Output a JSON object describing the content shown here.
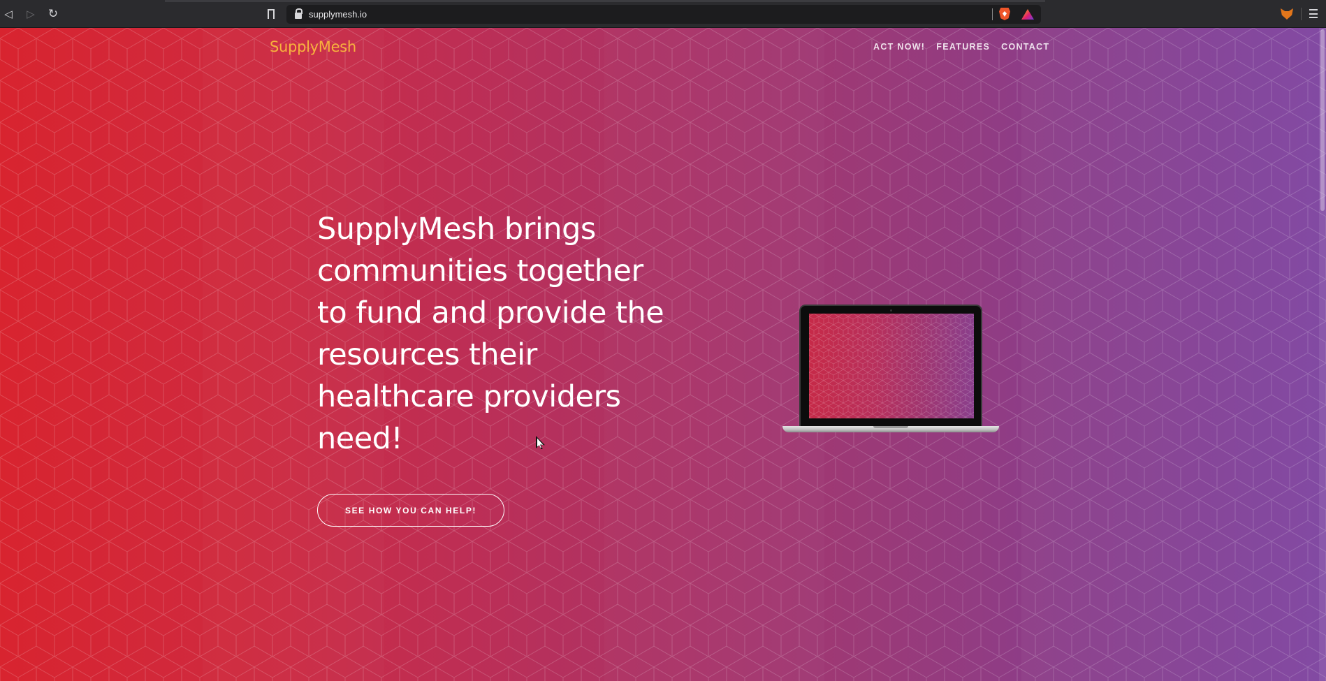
{
  "browser": {
    "url": "supplymesh.io",
    "icons": [
      "back-icon",
      "forward-icon",
      "reload-icon",
      "bookmark-icon",
      "lock-icon",
      "brave-shield-icon",
      "brave-rewards-icon",
      "metamask-icon",
      "menu-icon"
    ]
  },
  "site": {
    "brand": "SupplyMesh",
    "nav": [
      "ACT NOW!",
      "FEATURES",
      "CONTACT"
    ],
    "headline": "SupplyMesh brings communities together to fund and provide the resources their healthcare providers need!",
    "cta_label": "SEE HOW YOU CAN HELP!"
  },
  "colors": {
    "brand": "#f7b23d",
    "gradient_start": "#d8242f",
    "gradient_end": "#7e45a0",
    "text": "#ffffff"
  }
}
